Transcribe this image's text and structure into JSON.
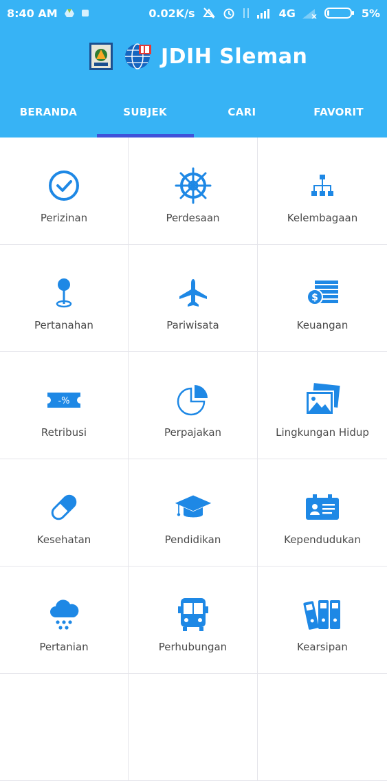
{
  "status_bar": {
    "time": "8:40 AM",
    "speed": "0.02K/s",
    "network": "4G",
    "battery": "5%"
  },
  "header": {
    "title": "JDIH Sleman"
  },
  "tabs": [
    {
      "label": "BERANDA"
    },
    {
      "label": "SUBJEK"
    },
    {
      "label": "CARI"
    },
    {
      "label": "FAVORIT"
    }
  ],
  "active_tab": "SUBJEK",
  "subjects": [
    {
      "label": "Perizinan",
      "icon": "check-circle-icon"
    },
    {
      "label": "Perdesaan",
      "icon": "ship-wheel-icon"
    },
    {
      "label": "Kelembagaan",
      "icon": "org-chart-icon"
    },
    {
      "label": "Pertanahan",
      "icon": "map-pin-icon"
    },
    {
      "label": "Pariwisata",
      "icon": "airplane-icon"
    },
    {
      "label": "Keuangan",
      "icon": "money-stack-icon"
    },
    {
      "label": "Retribusi",
      "icon": "discount-ticket-icon"
    },
    {
      "label": "Perpajakan",
      "icon": "pie-chart-icon"
    },
    {
      "label": "Lingkungan Hidup",
      "icon": "photo-gallery-icon"
    },
    {
      "label": "Kesehatan",
      "icon": "pill-icon"
    },
    {
      "label": "Pendidikan",
      "icon": "graduation-cap-icon"
    },
    {
      "label": "Kependudukan",
      "icon": "id-card-icon"
    },
    {
      "label": "Pertanian",
      "icon": "rain-cloud-icon"
    },
    {
      "label": "Perhubungan",
      "icon": "bus-icon"
    },
    {
      "label": "Kearsipan",
      "icon": "archive-binders-icon"
    }
  ],
  "colors": {
    "app_bar": "#37b3f5",
    "tab_indicator": "#3f51d9",
    "icon": "#1e88e5",
    "label_text": "#4a4a4a"
  }
}
